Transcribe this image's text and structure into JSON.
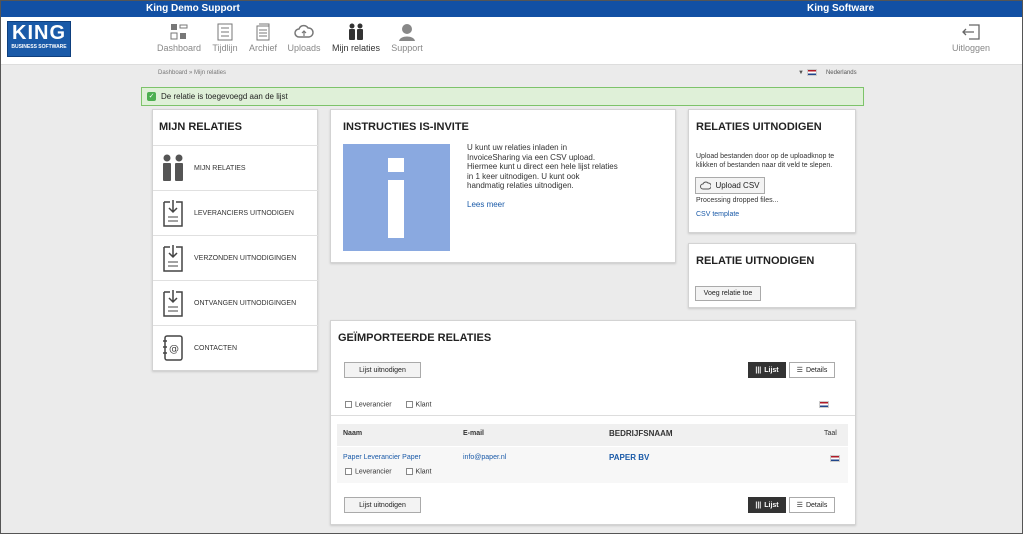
{
  "topbar": {
    "left": "King Demo Support",
    "right": "King Software"
  },
  "logo": {
    "big": "KING",
    "small": "BUSINESS SOFTWARE"
  },
  "nav": [
    {
      "label": "Dashboard"
    },
    {
      "label": "Tijdlijn"
    },
    {
      "label": "Archief"
    },
    {
      "label": "Uploads"
    },
    {
      "label": "Mijn relaties"
    },
    {
      "label": "Support"
    }
  ],
  "logout": {
    "label": "Uitloggen"
  },
  "breadcrumb": {
    "home": "Dashboard",
    "sep": "»",
    "current": "Mijn relaties"
  },
  "language": {
    "label": "Nederlands"
  },
  "alert": {
    "text": "De relatie is toegevoegd aan de lijst"
  },
  "sidebar": {
    "title": "MIJN RELATIES",
    "items": [
      {
        "label": "MIJN RELATIES"
      },
      {
        "label": "LEVERANCIERS UITNODIGEN"
      },
      {
        "label": "VERZONDEN UITNODIGINGEN"
      },
      {
        "label": "ONTVANGEN UITNODIGINGEN"
      },
      {
        "label": "CONTACTEN"
      }
    ]
  },
  "instructions": {
    "title": "INSTRUCTIES IS-INVITE",
    "lines": [
      "U kunt uw relaties inladen in",
      "InvoiceSharing via een CSV upload.",
      "Hiermee kunt u direct een hele lijst relaties",
      "in 1 keer uitnodigen. U kunt ook",
      "handmatig relaties uitnodigen."
    ],
    "link": "Lees meer"
  },
  "invite": {
    "title": "RELATIES UITNODIGEN",
    "lines": [
      "Upload bestanden door op de uploadknop te",
      "klikken of bestanden naar dit veld te slepen."
    ],
    "upload_button": "Upload CSV",
    "processing": "Processing dropped files...",
    "template_link": "CSV template"
  },
  "single_invite": {
    "title": "RELATIE UITNODIGEN",
    "button": "Voeg relatie toe"
  },
  "imported": {
    "title": "GEÏMPORTEERDE RELATIES",
    "invite_button": "Lijst uitnodigen",
    "view_list": "Lijst",
    "view_details": "Details",
    "filter_leverancier": "Leverancier",
    "filter_klant": "Klant",
    "columns": [
      "Naam",
      "E-mail",
      "BEDRIJFSNAAM",
      "Taal"
    ],
    "rows": [
      {
        "name": "Paper Leverancier Paper",
        "email": "info@paper.nl",
        "company": "PAPER BV",
        "leverancier": "Leverancier",
        "klant": "Klant"
      }
    ]
  },
  "colors": {
    "brand": "#1250a4",
    "alert_bg": "#dff0d8",
    "info_tile": "#8aa9e0"
  }
}
